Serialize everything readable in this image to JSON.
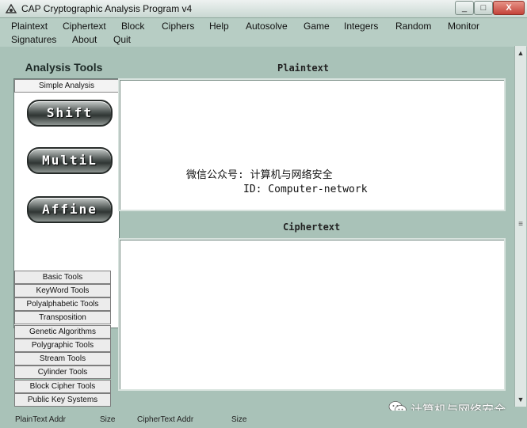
{
  "window": {
    "title": "CAP  Cryptographic Analysis Program v4",
    "app_icon": "cap-app-icon",
    "min_glyph": "_",
    "max_glyph": "□",
    "close_glyph": "X"
  },
  "menu": {
    "row1": [
      "Plaintext",
      "Ciphertext",
      "Block",
      "Ciphers",
      "Help",
      "Autosolve",
      "Game",
      "Integers",
      "Random",
      "Monitor"
    ],
    "row2": [
      "Signatures",
      "About",
      "Quit"
    ]
  },
  "sidebar": {
    "title": "Analysis Tools",
    "active_tab": "Simple Analysis",
    "big_buttons": [
      "Shift",
      "MultiL",
      "Affine"
    ],
    "tools": [
      "Basic Tools",
      "KeyWord Tools",
      "Polyalphabetic Tools",
      "Transposition",
      "Genetic Algorithms",
      "Polygraphic Tools",
      "Stream Tools",
      "Cylinder Tools",
      "Block Cipher Tools",
      "Public Key Systems"
    ]
  },
  "plaintext": {
    "label": "Plaintext",
    "line1": "微信公众号: 计算机与网络安全",
    "line2": "ID: Computer-network"
  },
  "ciphertext": {
    "label": "Ciphertext"
  },
  "status": {
    "plain_addr": "PlainText Addr",
    "plain_size": "Size",
    "cipher_addr": "CipherText Addr",
    "cipher_size": "Size"
  },
  "watermark": {
    "text": "计算机与网络安全",
    "icon": "wechat-icon"
  },
  "scrollbar": {
    "up_glyph": "▲",
    "grip_glyph": "≡",
    "down_glyph": "▼"
  },
  "colors": {
    "window_bg": "#a9c2b8",
    "menu_bg": "#b7cdc4",
    "button_dark": "#2f3533"
  }
}
